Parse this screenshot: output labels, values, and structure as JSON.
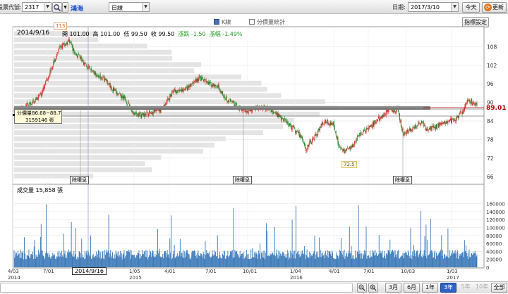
{
  "toolbar": {
    "stock_code_label": "股票代號:",
    "stock_code_value": "2317",
    "stock_name": "鴻海",
    "period_value": "日線",
    "date_label": "日期:",
    "date_value": "2017/3/10",
    "today_button": "今天",
    "refresh_button": "更新"
  },
  "legend": {
    "kline_label": "K線",
    "volume_profile_label": "分價量統計",
    "settings_button": "指標設定"
  },
  "info": {
    "date": "2014/9/16",
    "open": "開 101.00",
    "high": "高 101.00",
    "low": "低 99.50",
    "close": "收 99.50",
    "change": "漲跌 -1.50",
    "pct": "漲幅 -1.49%"
  },
  "markers": {
    "peak_label": "113",
    "trough_label": "72.5",
    "current_price": "89.01",
    "ex_dividend_label": "除權息",
    "profile_tooltip_line1": "分價量86.68~88.7",
    "profile_tooltip_line2": "3159146 張"
  },
  "volume": {
    "title": "成交量 15,858 張"
  },
  "cursor_date": "2014/9/16",
  "periods": {
    "m3": "3月",
    "m6": "6月",
    "y1": "1年",
    "y3": "3年",
    "y5": "5年",
    "y10": "10年",
    "all": "全部"
  },
  "chart_data": {
    "type": "candlestick",
    "y_price_ticks": [
      108,
      102,
      96,
      90,
      84,
      78,
      72,
      66
    ],
    "y_volume_ticks": [
      "160000",
      "140000",
      "120000",
      "100000",
      "80000",
      "60000",
      "40000",
      "20000",
      "0"
    ],
    "x_ticks": [
      {
        "label": "4/03",
        "year": "2014"
      },
      {
        "label": "7/01",
        "year": ""
      },
      {
        "label": "10/01",
        "year": ""
      },
      {
        "label": "1/05",
        "year": "2015"
      },
      {
        "label": "4/01",
        "year": ""
      },
      {
        "label": "7/01",
        "year": ""
      },
      {
        "label": "10/01",
        "year": ""
      },
      {
        "label": "1/04",
        "year": "2016"
      },
      {
        "label": "4/01",
        "year": ""
      },
      {
        "label": "7/01",
        "year": ""
      },
      {
        "label": "10/03",
        "year": ""
      },
      {
        "label": "1/03",
        "year": "2017"
      }
    ],
    "price_range": [
      64,
      114
    ],
    "volume_max": 170000,
    "price_path": [
      [
        0,
        87
      ],
      [
        0.02,
        88
      ],
      [
        0.04,
        90
      ],
      [
        0.06,
        93
      ],
      [
        0.08,
        101
      ],
      [
        0.1,
        108
      ],
      [
        0.12,
        110
      ],
      [
        0.13,
        106
      ],
      [
        0.145,
        104
      ],
      [
        0.16,
        101
      ],
      [
        0.18,
        99
      ],
      [
        0.2,
        97
      ],
      [
        0.22,
        93
      ],
      [
        0.24,
        91
      ],
      [
        0.26,
        86
      ],
      [
        0.28,
        86
      ],
      [
        0.3,
        87
      ],
      [
        0.32,
        88
      ],
      [
        0.34,
        93
      ],
      [
        0.37,
        94
      ],
      [
        0.4,
        98
      ],
      [
        0.42,
        96
      ],
      [
        0.44,
        95
      ],
      [
        0.46,
        91
      ],
      [
        0.48,
        89
      ],
      [
        0.5,
        87
      ],
      [
        0.52,
        88
      ],
      [
        0.55,
        88
      ],
      [
        0.58,
        85
      ],
      [
        0.6,
        82
      ],
      [
        0.62,
        79
      ],
      [
        0.63,
        75
      ],
      [
        0.65,
        79
      ],
      [
        0.67,
        84
      ],
      [
        0.69,
        83
      ],
      [
        0.7,
        77
      ],
      [
        0.71,
        74
      ],
      [
        0.73,
        76
      ],
      [
        0.75,
        80
      ],
      [
        0.77,
        82
      ],
      [
        0.79,
        85
      ],
      [
        0.81,
        88
      ],
      [
        0.83,
        87
      ],
      [
        0.84,
        80
      ],
      [
        0.86,
        81
      ],
      [
        0.88,
        84
      ],
      [
        0.89,
        81
      ],
      [
        0.91,
        82
      ],
      [
        0.93,
        84
      ],
      [
        0.95,
        84
      ],
      [
        0.97,
        87
      ],
      [
        0.98,
        91
      ],
      [
        1.0,
        89
      ]
    ]
  },
  "colors": {
    "up": "#d42a2a",
    "down": "#2a8a2a",
    "volume": "#3a78b8",
    "profile": "#d9d9d9",
    "highlight_row": "#888888",
    "price_tag": "#b00000",
    "change_green": "#1e9a1e"
  }
}
